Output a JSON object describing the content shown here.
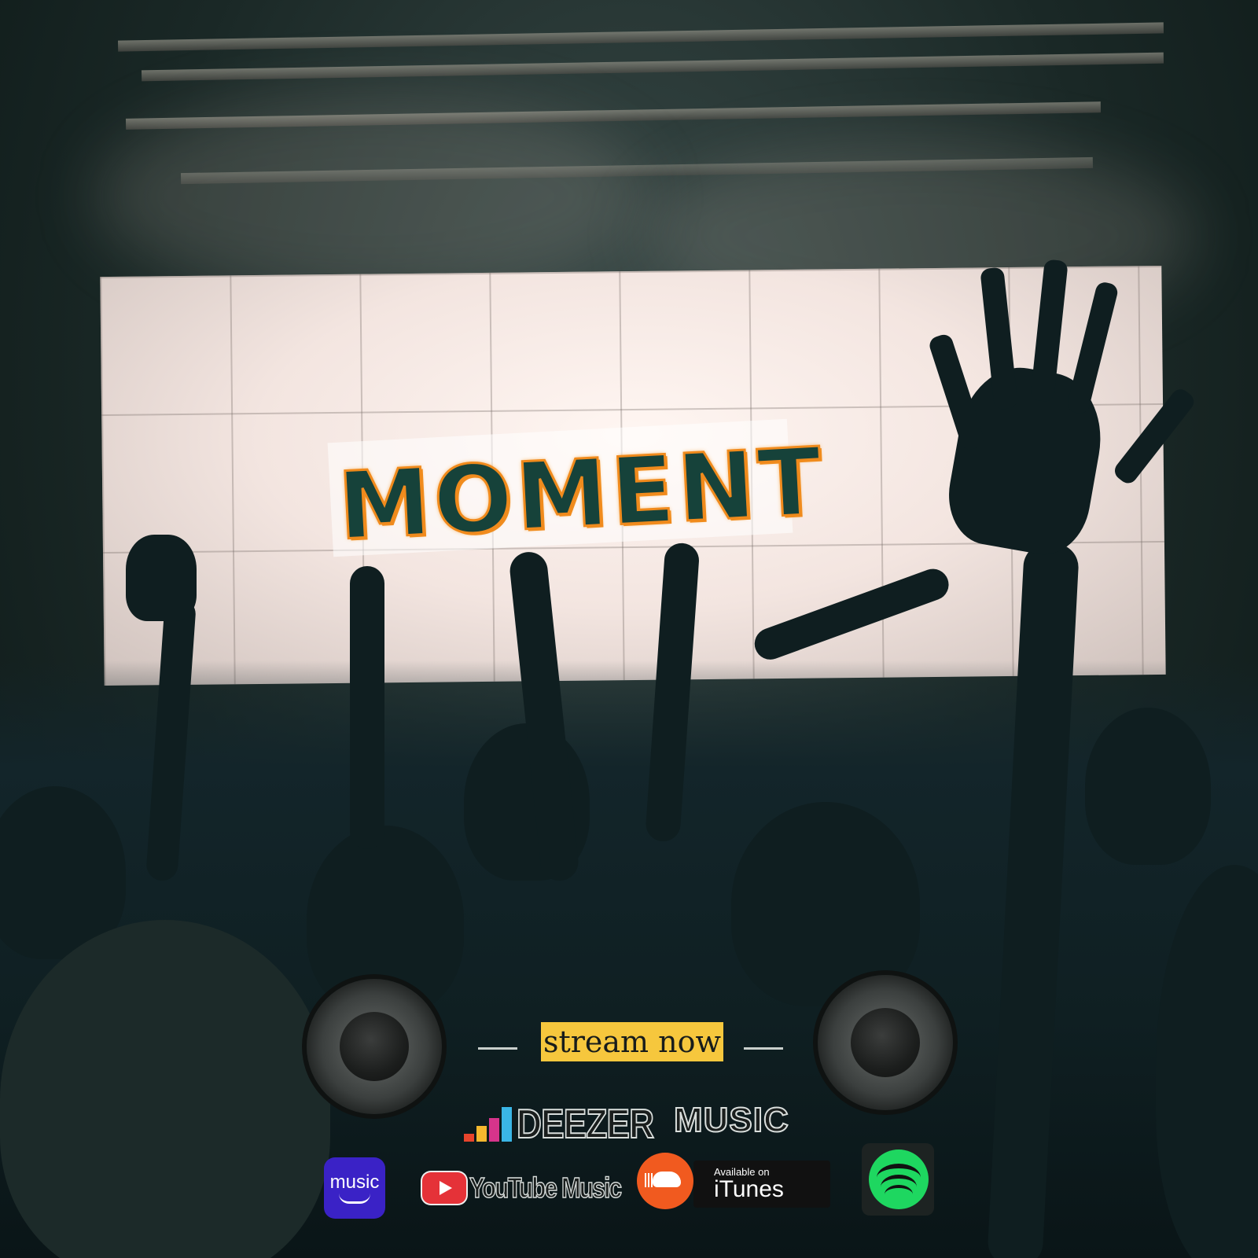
{
  "poster": {
    "title": "MOMENT",
    "cta": "stream now"
  },
  "platforms": {
    "deezer": "DEEZER",
    "apple_music": "MUSIC",
    "amazon_music": "music",
    "youtube_music": "YouTube Music",
    "itunes_small": "Available on",
    "itunes_large": "iTunes"
  },
  "colors": {
    "title_fill": "#16423a",
    "title_outline": "#f08a1c",
    "cta_background": "#f6c73d",
    "amazon": "#3a22c6",
    "youtube": "#e53238",
    "soundcloud": "#f15a1f",
    "spotify": "#1ed760"
  },
  "icons": {
    "deezer": "deezer-icon",
    "apple": "apple-icon",
    "amazon": "amazon-music-icon",
    "youtube": "youtube-play-icon",
    "soundcloud": "soundcloud-icon",
    "itunes": "itunes-icon",
    "spotify": "spotify-icon"
  }
}
